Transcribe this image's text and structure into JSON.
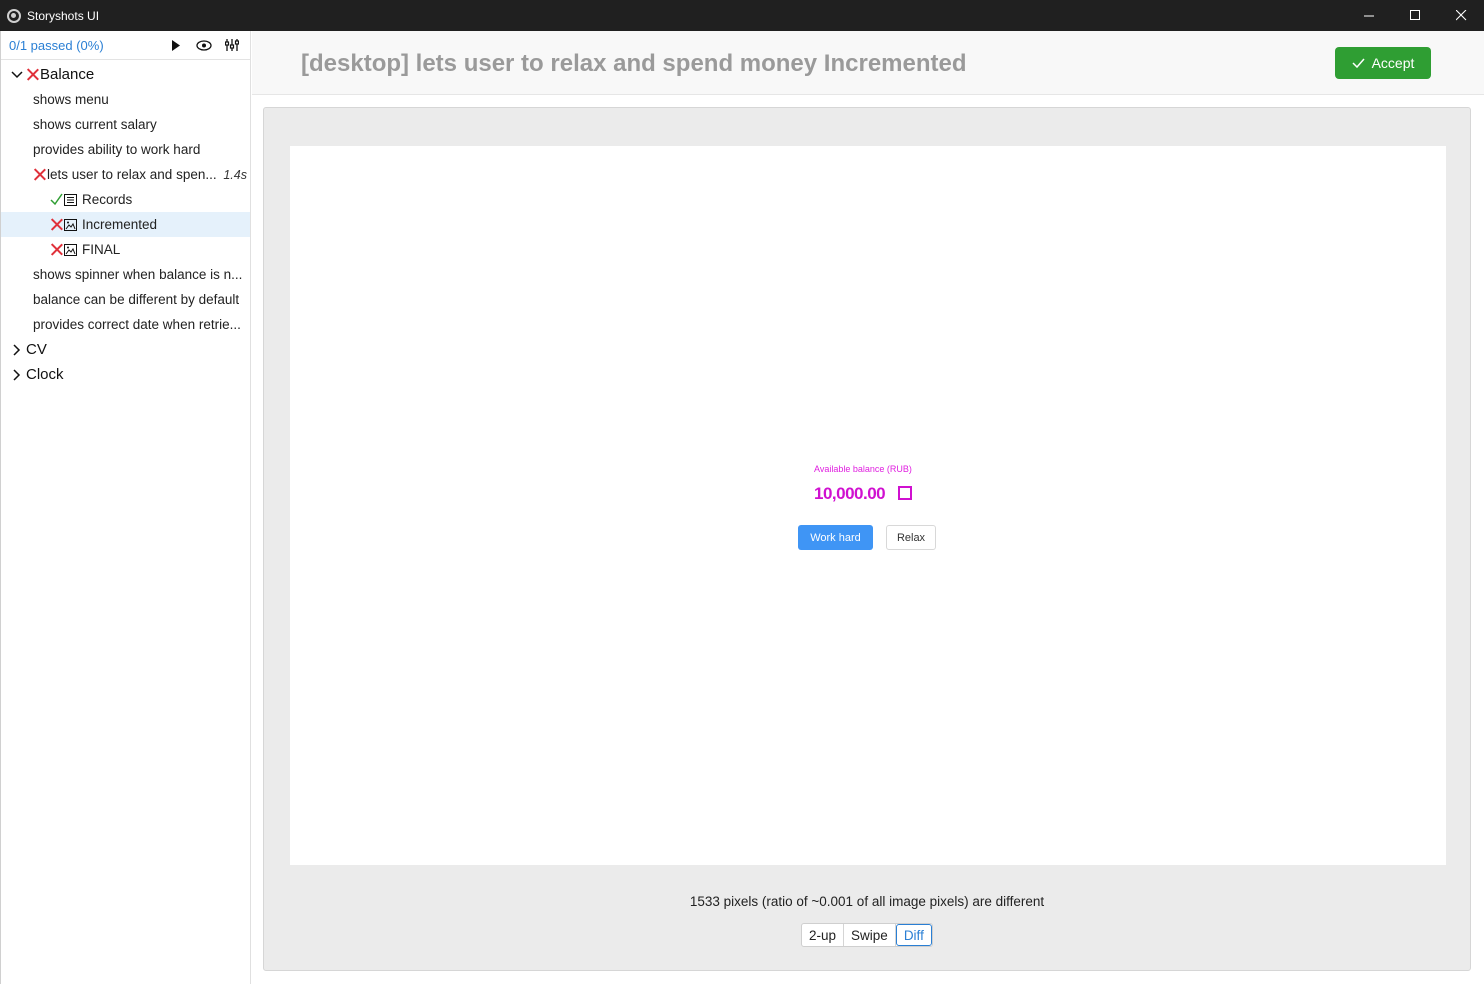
{
  "window": {
    "title": "Storyshots UI"
  },
  "sidebar": {
    "passed": "0/1 passed (0%)",
    "tools": [
      {
        "name": "play-icon"
      },
      {
        "name": "eye-icon"
      },
      {
        "name": "settings-icon"
      }
    ],
    "tree": {
      "balance": "Balance",
      "items": [
        "shows menu",
        "shows current salary",
        "provides ability to work hard"
      ],
      "failed_story": {
        "label": "lets user to relax and spen...",
        "time": "1.4s"
      },
      "steps": [
        {
          "label": "Records",
          "status": "pass",
          "type": "records"
        },
        {
          "label": "Incremented",
          "status": "fail",
          "type": "screenshot"
        },
        {
          "label": "FINAL",
          "status": "fail",
          "type": "screenshot"
        }
      ],
      "more_items": [
        "shows spinner when balance is n...",
        "balance can be different by default",
        "provides correct date when retrie..."
      ],
      "cv": "CV",
      "clock": "Clock"
    }
  },
  "header": {
    "title": "[desktop] lets user to relax and spend money Incremented",
    "accept": "Accept"
  },
  "preview": {
    "label": "Available balance (RUB)",
    "value": "10,000.00",
    "work_hard": "Work hard",
    "relax": "Relax"
  },
  "diff": {
    "text": "1533 pixels (ratio of ~0.001 of all image pixels) are different",
    "modes": [
      "2-up",
      "Swipe",
      "Diff"
    ],
    "active_mode": "Diff"
  },
  "colors": {
    "accent": "#2a7fd4",
    "accept": "#2f9e33",
    "fail": "#e0303a",
    "pass": "#2f9e33",
    "diff": "#e020e0"
  }
}
